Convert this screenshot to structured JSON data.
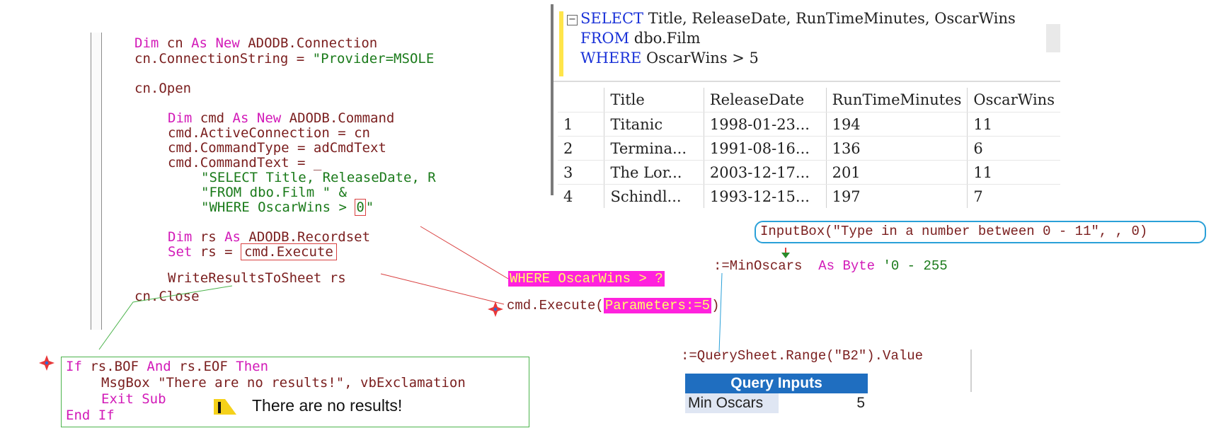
{
  "vba_code": {
    "l1a": "Dim",
    "l1b": " cn ",
    "l1c": "As",
    "l1d": " ",
    "l1e": "New",
    "l1f": " ADODB.Connection",
    "l2": "cn.ConnectionString = ",
    "l2s": "\"Provider=MSOLE",
    "l3": "cn.Open",
    "l4a": "Dim",
    "l4b": " cmd ",
    "l4c": "As",
    "l4e": "New",
    "l4f": " ADODB.Command",
    "l5": "cmd.ActiveConnection = cn",
    "l6": "cmd.CommandType = adCmdText",
    "l7": "cmd.CommandText = _",
    "l8": "\"SELECT Title, ReleaseDate, R",
    "l9": "\"FROM dbo.Film \" &",
    "l10a": "\"WHERE OscarWins > ",
    "l10b": "0",
    "l10c": "\"",
    "l11a": "Dim",
    "l11b": " rs ",
    "l11c": "As",
    "l11f": " ADODB.Recordset",
    "l12a": "Set",
    "l12b": " rs = ",
    "l12c": "cmd.Execute",
    "l13": "WriteResultsToSheet rs",
    "l14": "cn.Close"
  },
  "sql_editor": {
    "collapse": "−",
    "l1kw": "SELECT",
    "l1": " Title, ReleaseDate, RunTimeMinutes, OscarWins",
    "l2kw": "FROM",
    "l2": " dbo.Film",
    "l3kw": "WHERE",
    "l3": " OscarWins > 5"
  },
  "results": {
    "headers": [
      "",
      "Title",
      "ReleaseDate",
      "RunTimeMinutes",
      "OscarWins"
    ],
    "rows": [
      [
        "1",
        "Titanic",
        "1998-01-23...",
        "194",
        "11"
      ],
      [
        "2",
        "Termina...",
        "1991-08-16...",
        "136",
        "6"
      ],
      [
        "3",
        "The Lor...",
        "2003-12-17...",
        "201",
        "11"
      ],
      [
        "4",
        "Schindl...",
        "1993-12-15...",
        "197",
        "7"
      ]
    ]
  },
  "annotations": {
    "inputbox": "InputBox(\"Type in a number between 0 - 11\", , 0)",
    "minoscars_prefix": ":=MinOscars",
    "as_byte": "As Byte",
    "byte_comment": "'0 - 255",
    "where_param": "WHERE OscarWins > ?",
    "cmd_execute": "cmd.Execute(",
    "parameters": "Parameters:=5",
    "close_paren": ")",
    "queryrange": ":=QuerySheet.Range(\"B2\").Value"
  },
  "error_block": {
    "l1a": "If",
    "l1b": " rs.BOF ",
    "l1c": "And",
    "l1d": " rs.EOF ",
    "l1e": "Then",
    "l2": "MsgBox \"There are no results!\", vbExclamation",
    "l3": "Exit Sub",
    "l4": "End If"
  },
  "message": {
    "text": "There are no results!",
    "icon": "exclamation-icon"
  },
  "query_inputs": {
    "header": "Query Inputs",
    "label": "Min Oscars",
    "value": "5"
  },
  "colors": {
    "keyword": "#d21ab8",
    "string": "#1a7a1a",
    "text": "#7a1e1e",
    "sql_keyword": "#1a32d8",
    "highlight": "#ff22dd",
    "header_blue": "#1f6ec0"
  }
}
